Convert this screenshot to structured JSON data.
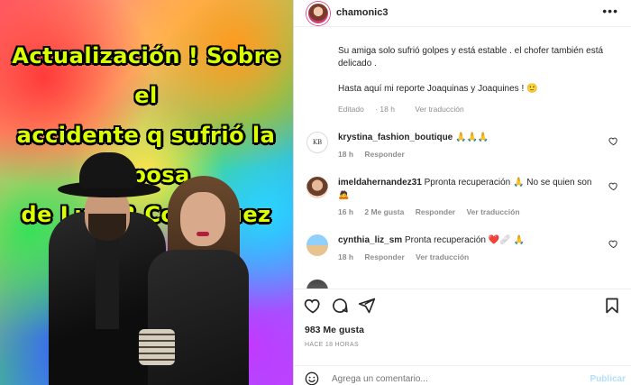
{
  "image": {
    "headline_lines": [
      "Actualización ! Sobre el",
      "accidente q sufrió la esposa",
      "de Luis R Conriquez"
    ]
  },
  "post": {
    "username": "chamonic3",
    "more_icon": "ellipsis-icon",
    "caption_line1": "Su amiga solo sufrió golpes y está estable . el chofer también está delicado .",
    "caption_line2": "Hasta aquí mi reporte Joaquinas y Joaquines ! 🙂",
    "edited_label": "Editado",
    "edited_time": "18 h",
    "translate_label": "Ver traducción"
  },
  "comments": [
    {
      "username": "krystina_fashion_boutique",
      "text": "🙏🙏🙏",
      "time": "18 h",
      "likes": "",
      "reply": "Responder",
      "translate": "",
      "avatar_text": "KB"
    },
    {
      "username": "imeldahernandez31",
      "text": "Ppronta recuperación 🙏 No se quien son 🙇",
      "time": "16 h",
      "likes": "2 Me gusta",
      "reply": "Responder",
      "translate": "Ver traducción"
    },
    {
      "username": "cynthia_liz_sm",
      "text": "Pronta recuperación ❤️🩹 🙏",
      "time": "18 h",
      "likes": "",
      "reply": "Responder",
      "translate": "Ver traducción"
    }
  ],
  "actions": {
    "likes_count": "983 Me gusta",
    "post_time": "HACE 18 HORAS"
  },
  "composer": {
    "placeholder": "Agrega un comentario...",
    "publish_label": "Publicar"
  },
  "colors": {
    "headline": "#d9ff00",
    "publish": "#b2dffc",
    "meta": "#8e8e8e"
  }
}
